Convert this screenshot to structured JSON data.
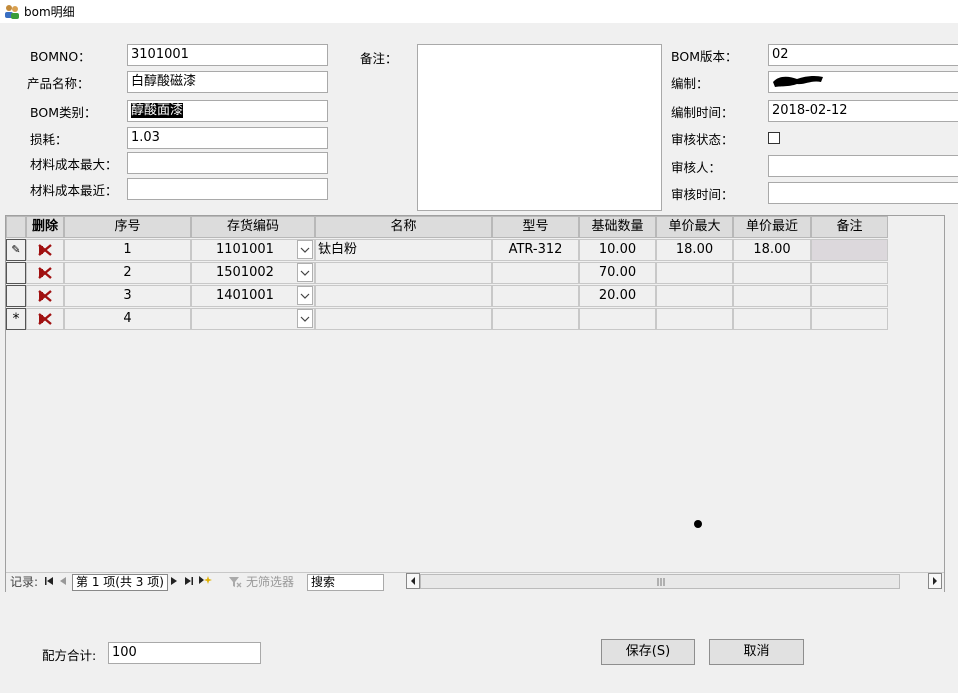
{
  "window": {
    "title": "bom明细"
  },
  "form": {
    "bomno_label": "BOMNO：",
    "bomno": "3101001",
    "product_label": "产品名称：",
    "product": "白醇酸磁漆",
    "bomtype_label": "BOM类别：",
    "bomtype": "醇酸面漆",
    "loss_label": "损耗：",
    "loss": "1.03",
    "cost_max_label": "材料成本最大：",
    "cost_max": "",
    "cost_recent_label": "材料成本最近：",
    "cost_recent": "",
    "remark_label": "备注：",
    "remark": "",
    "version_label": "BOM版本：",
    "version": "02",
    "author_label": "编制：",
    "author": "",
    "author_time_label": "编制时间：",
    "author_time": "2018-02-12",
    "audit_status_label": "审核状态：",
    "auditor_label": "审核人：",
    "auditor": "",
    "audit_time_label": "审核时间：",
    "audit_time": ""
  },
  "grid": {
    "columns": [
      "删除",
      "序号",
      "存货编码",
      "名称",
      "型号",
      "基础数量",
      "单价最大",
      "单价最近",
      "备注"
    ],
    "rows": [
      {
        "seq": "1",
        "code": "1101001",
        "name": "钛白粉",
        "model": "ATR-312",
        "qty": "10.00",
        "price_max": "18.00",
        "price_recent": "18.00",
        "note": ""
      },
      {
        "seq": "2",
        "code": "1501002",
        "name": "",
        "model": "",
        "qty": "70.00",
        "price_max": "",
        "price_recent": "",
        "note": ""
      },
      {
        "seq": "3",
        "code": "1401001",
        "name": "",
        "model": "",
        "qty": "20.00",
        "price_max": "",
        "price_recent": "",
        "note": ""
      },
      {
        "seq": "4",
        "code": "",
        "name": "",
        "model": "",
        "qty": "",
        "price_max": "",
        "price_recent": "",
        "note": ""
      }
    ],
    "row_markers": [
      "✎",
      "",
      "",
      "*"
    ]
  },
  "navigator": {
    "record_label": "记录:",
    "position": "第 1 项(共 3 项)",
    "filter": "无筛选器",
    "search": "搜索"
  },
  "footer": {
    "total_label": "配方合计:",
    "total": "100",
    "save": "保存(S)",
    "cancel": "取消"
  }
}
